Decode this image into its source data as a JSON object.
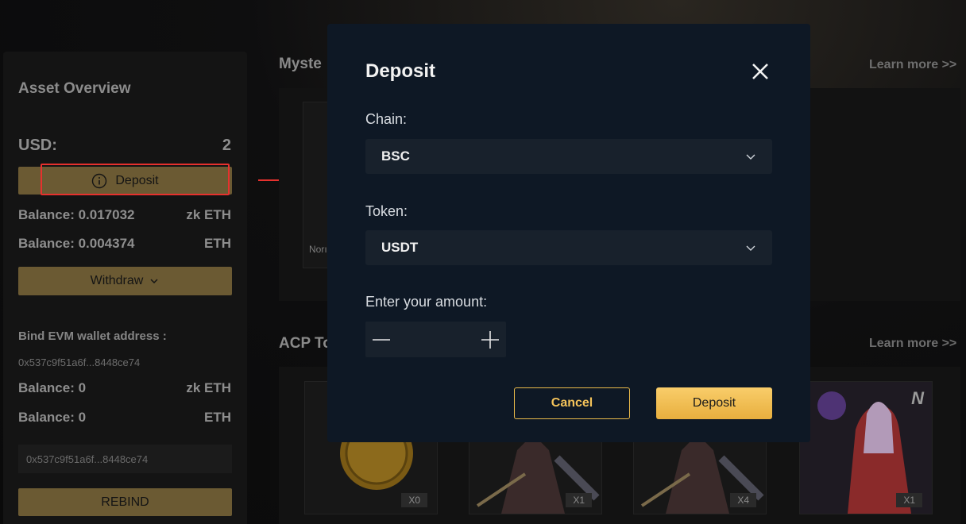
{
  "sidebar": {
    "title": "Asset Overview",
    "usd_label": "USD:",
    "usd_value": "2",
    "deposit_label": "Deposit",
    "balance1_label": "Balance: 0.017032",
    "balance1_unit": "zk ETH",
    "balance2_label": "Balance: 0.004374",
    "balance2_unit": "ETH",
    "withdraw_label": "Withdraw",
    "bind_label": "Bind EVM wallet address :",
    "bind_address": "0x537c9f51a6f...8448ce74",
    "balance3_label": "Balance: 0",
    "balance3_unit": "zk ETH",
    "balance4_label": "Balance: 0",
    "balance4_unit": "ETH",
    "address_box": "0x537c9f51a6f...8448ce74",
    "rebind_label": "REBIND"
  },
  "sections": {
    "mystery_title": "Myste",
    "mystery_learn": "Learn more >>",
    "mystery_card_caption": "Norı",
    "acp_title": "ACP To",
    "acp_learn": "Learn more >>",
    "badges": [
      "X0",
      "X1",
      "X4",
      "X1"
    ],
    "nft_letter": "N"
  },
  "modal": {
    "title": "Deposit",
    "chain_label": "Chain:",
    "chain_value": "BSC",
    "token_label": "Token:",
    "token_value": "USDT",
    "amount_label": "Enter your amount:",
    "cancel_label": "Cancel",
    "deposit_label": "Deposit"
  },
  "colors": {
    "accent": "#f4c35a",
    "modal_bg": "#0e1825",
    "highlight": "#e6312e"
  }
}
